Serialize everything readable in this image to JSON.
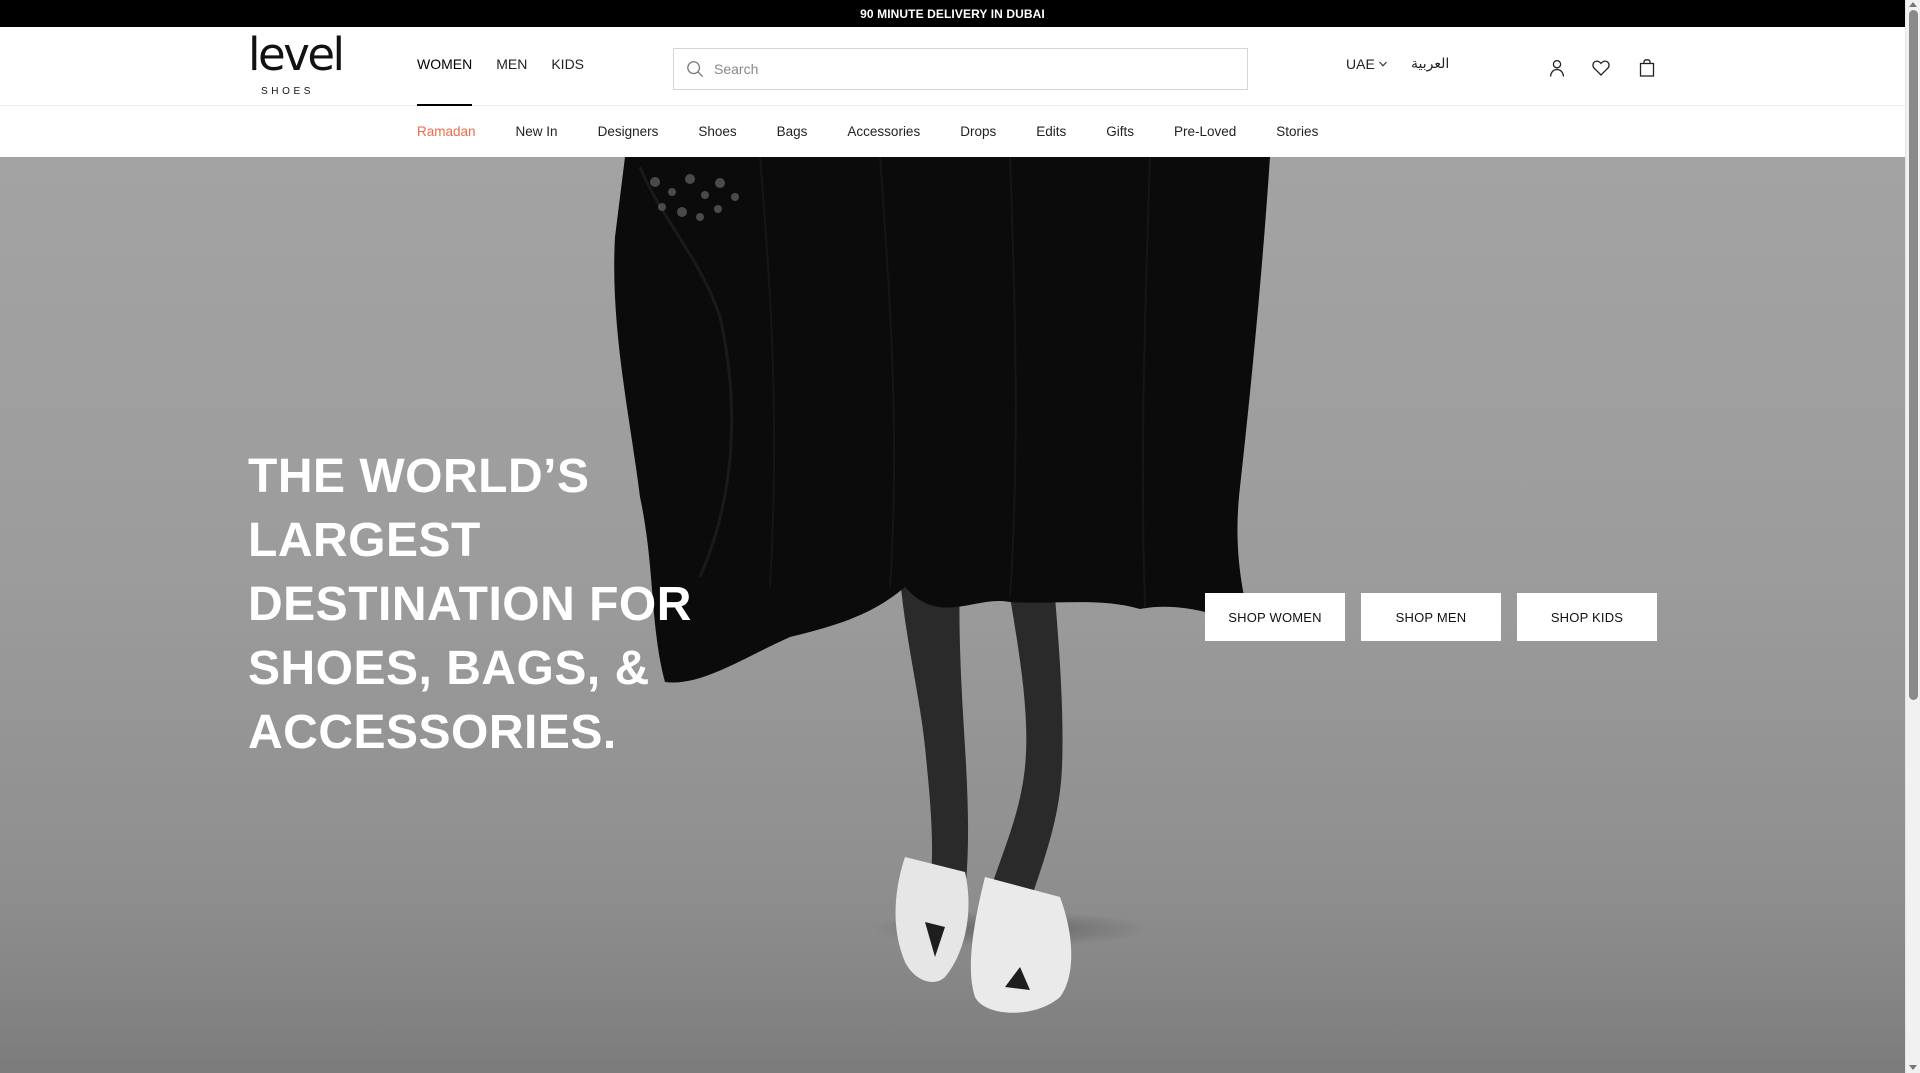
{
  "promo_bar": {
    "text": "90 MINUTE DELIVERY IN DUBAI"
  },
  "header": {
    "logo": {
      "word": "level",
      "sub": "SHOES"
    },
    "gender_tabs": [
      {
        "label": "WOMEN",
        "active": true
      },
      {
        "label": "MEN",
        "active": false
      },
      {
        "label": "KIDS",
        "active": false
      }
    ],
    "search": {
      "placeholder": "Search",
      "value": ""
    },
    "region": {
      "label": "UAE"
    },
    "language": {
      "label": "العربية"
    },
    "icons": [
      "account-icon",
      "wishlist-heart-icon",
      "shopping-bag-icon"
    ]
  },
  "category_nav": {
    "items": [
      {
        "label": "Ramadan",
        "highlight": true
      },
      {
        "label": "New In"
      },
      {
        "label": "Designers"
      },
      {
        "label": "Shoes"
      },
      {
        "label": "Bags"
      },
      {
        "label": "Accessories"
      },
      {
        "label": "Drops"
      },
      {
        "label": "Edits"
      },
      {
        "label": "Gifts"
      },
      {
        "label": "Pre-Loved"
      },
      {
        "label": "Stories"
      }
    ],
    "highlight_color": "#ec6b4c"
  },
  "hero": {
    "headline_lines": [
      "THE WORLD’S",
      "LARGEST",
      "DESTINATION FOR",
      "SHOES, BAGS, &",
      "ACCESSORIES."
    ],
    "ctas": [
      {
        "label": "SHOP WOMEN"
      },
      {
        "label": "SHOP MEN"
      },
      {
        "label": "SHOP KIDS"
      }
    ]
  }
}
